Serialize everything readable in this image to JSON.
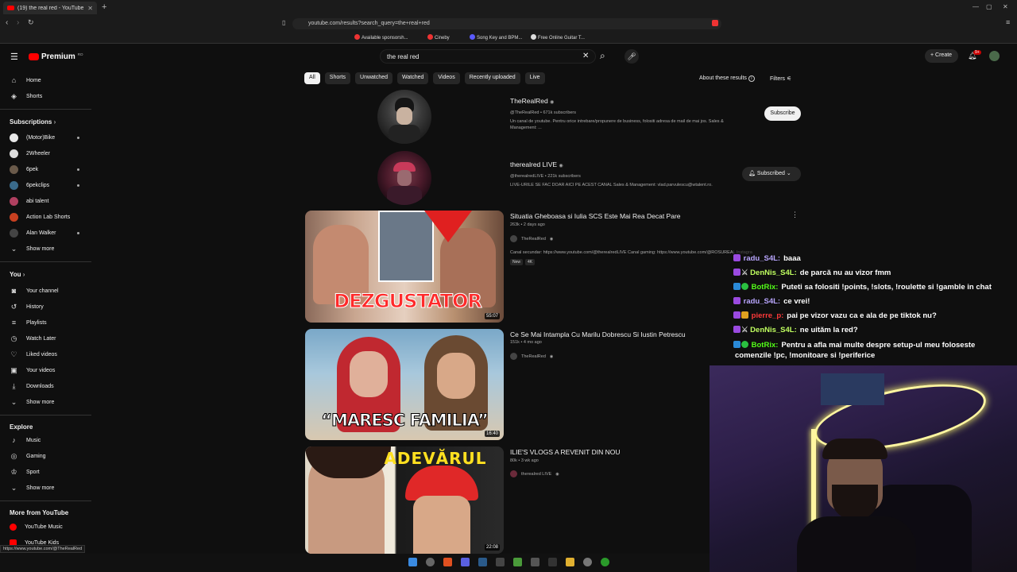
{
  "browser": {
    "tab_title": "(19) the real red - YouTube",
    "url": "youtube.com/results?search_query=the+real+red",
    "bookmarks": [
      "Available sponsorsh...",
      "Cineby",
      "Song Key and BPM...",
      "Free Online Guitar T..."
    ]
  },
  "header": {
    "logo": "Premium",
    "logo_sup": "RO",
    "search_value": "the real red",
    "create_label": "Create",
    "notif_count": "9+"
  },
  "sidebar": {
    "main": [
      {
        "label": "Home",
        "icon": "home-icon"
      },
      {
        "label": "Shorts",
        "icon": "shorts-icon"
      }
    ],
    "subscriptions_title": "Subscriptions",
    "subscriptions": [
      {
        "label": "(Motor)Bike",
        "color": "#e8e8e8",
        "new": true
      },
      {
        "label": "2Wheeler",
        "color": "#ddd",
        "new": false
      },
      {
        "label": "6pek",
        "color": "#6a5a4a",
        "new": true
      },
      {
        "label": "6pekclips",
        "color": "#3a6a8a",
        "new": true
      },
      {
        "label": "abi talent",
        "color": "#b04060",
        "new": false
      },
      {
        "label": "Action Lab Shorts",
        "color": "#c84020",
        "new": false
      },
      {
        "label": "Alan Walker",
        "color": "#444",
        "new": true
      }
    ],
    "show_more": "Show more",
    "you_title": "You",
    "you_items": [
      {
        "label": "Your channel",
        "icon": "channel-icon"
      },
      {
        "label": "History",
        "icon": "history-icon"
      },
      {
        "label": "Playlists",
        "icon": "playlists-icon"
      },
      {
        "label": "Watch Later",
        "icon": "clock-icon"
      },
      {
        "label": "Liked videos",
        "icon": "thumbs-up-icon"
      },
      {
        "label": "Your videos",
        "icon": "video-icon"
      },
      {
        "label": "Downloads",
        "icon": "download-icon"
      }
    ],
    "explore_title": "Explore",
    "explore_items": [
      {
        "label": "Music",
        "icon": "music-icon"
      },
      {
        "label": "Gaming",
        "icon": "gaming-icon"
      },
      {
        "label": "Sport",
        "icon": "trophy-icon"
      }
    ],
    "more_title": "More from YouTube",
    "more_items": [
      {
        "label": "YouTube Music"
      },
      {
        "label": "YouTube Kids"
      }
    ],
    "status_url": "https://www.youtube.com/@TheRealRed"
  },
  "filters": {
    "chips": [
      "All",
      "Shorts",
      "Unwatched",
      "Watched",
      "Videos",
      "Recently uploaded",
      "Live"
    ],
    "about": "About these results",
    "filters_label": "Filters"
  },
  "channels": [
    {
      "name": "TheRealRed",
      "meta": "@TheRealRed • 671k subscribers",
      "desc1": "Un canal de youtube. Pentru orice intrebare/propunere de business, folositi adresa de mail de mai jos. Sales &",
      "desc2": "Management: ...",
      "button": "Subscribe"
    },
    {
      "name": "therealred LIVE",
      "meta": "@therealredLIVE • 221k subscribers",
      "desc1": "LIVE-URILE SE FAC DOAR AICI PE ACEST CANAL Sales & Management: vlad.parvulescu@wtalent.ro.",
      "button": "Subscribed"
    }
  ],
  "videos": [
    {
      "title": "Situatia Gheboasa si Iulia SCS Este Mai Rea Decat Pare",
      "meta": "263k • 2 days ago",
      "channel": "TheRealRed",
      "desc": "Canal secundar: https://www.youtube.com/@therealredLIVE Canal gaming: https://www.youtube.com/@ROSUREAL Instagram:",
      "badges": [
        "New",
        "4K"
      ],
      "overlay": "DEZGUSTATOR",
      "duration": "55:07"
    },
    {
      "title": "Ce Se Mai Intampla Cu Marilu Dobrescu Si Iustin Petrescu",
      "meta": "151k • 4 mo ago",
      "channel": "TheRealRed",
      "overlay": "“MARESC FAMILIA”",
      "duration": "16:40"
    },
    {
      "title": "ILIE'S VLOGS A REVENIT DIN NOU",
      "meta": "80k • 3 wk ago",
      "channel": "therealred LIVE",
      "overlay": "ADEVĂRUL",
      "duration": "22:08"
    }
  ],
  "chat": [
    {
      "user": "radu_S4L:",
      "msg": "baaa",
      "color": "#b9a6ff"
    },
    {
      "user": "DenNis_S4L:",
      "msg": "de parcă nu au vizor fmm",
      "color": "#c0ff60"
    },
    {
      "user": "BotRix:",
      "msg": "Puteti sa folositi !points, !slots, !roulette si !gamble in chat",
      "color": "#53fc18"
    },
    {
      "user": "radu_S4L:",
      "msg": "ce vrei!",
      "color": "#b9a6ff"
    },
    {
      "user": "pierre_p:",
      "msg": "pai pe vizor vazu ca e ala de pe tiktok nu?",
      "color": "#ff3a3a"
    },
    {
      "user": "DenNis_S4L:",
      "msg": "ne uităm la red?",
      "color": "#c0ff60"
    },
    {
      "user": "BotRix:",
      "msg": "Pentru a afla mai multe despre setup-ul meu foloseste",
      "msg2": "comenzile !pc, !monitoare si !periferice",
      "color": "#53fc18"
    }
  ]
}
